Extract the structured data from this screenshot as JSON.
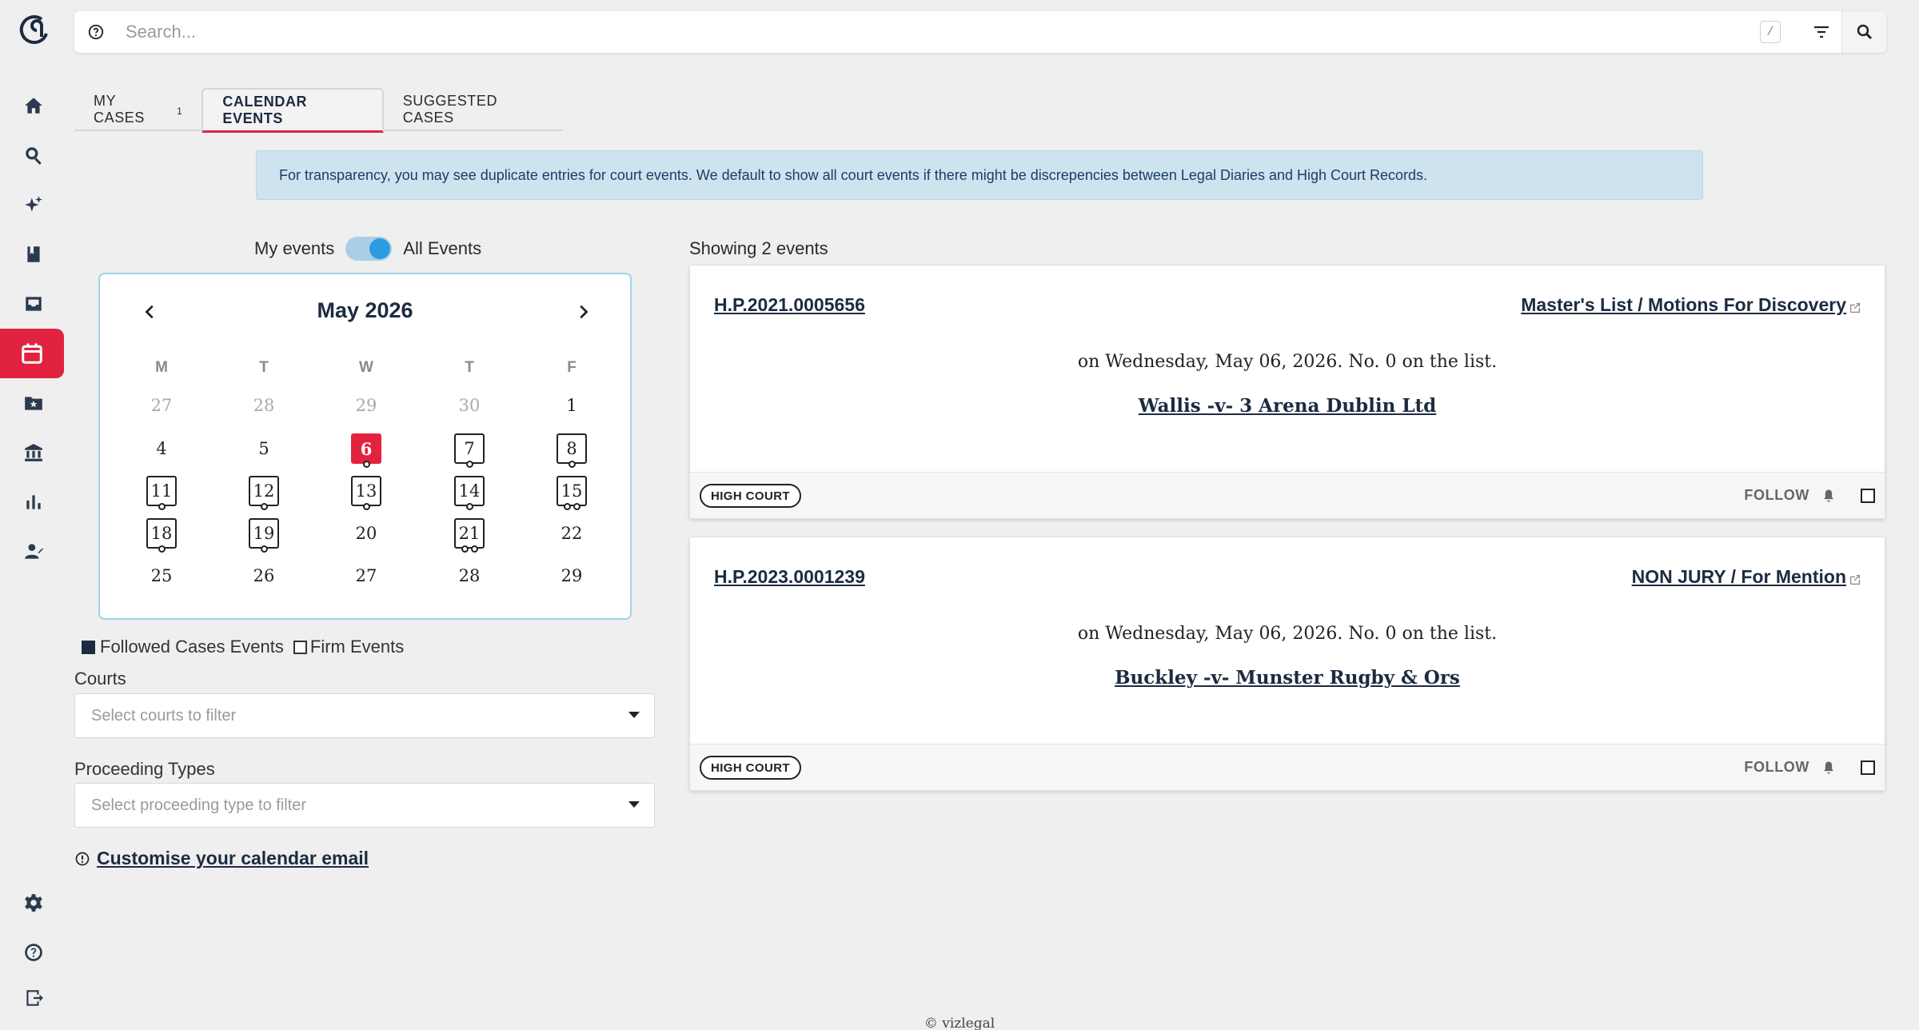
{
  "search": {
    "placeholder": "Search...",
    "shortcut": "/"
  },
  "tabs": [
    {
      "label": "MY CASES",
      "count": "1"
    },
    {
      "label": "CALENDAR EVENTS"
    },
    {
      "label": "SUGGESTED CASES"
    }
  ],
  "active_tab": "CALENDAR EVENTS",
  "banner": "For transparency, you may see duplicate entries for court events. We default to show all court events if there might be discrepencies between Legal Diaries and High Court Records.",
  "toggle": {
    "left_label": "My events",
    "right_label": "All Events",
    "state": "All Events"
  },
  "calendar": {
    "month": "May 2026",
    "weekdays": [
      "M",
      "T",
      "W",
      "T",
      "F"
    ],
    "weeks": [
      [
        {
          "d": "27",
          "muted": true
        },
        {
          "d": "28",
          "muted": true
        },
        {
          "d": "29",
          "muted": true
        },
        {
          "d": "30",
          "muted": true
        },
        {
          "d": "1"
        }
      ],
      [
        {
          "d": "4"
        },
        {
          "d": "5"
        },
        {
          "d": "6",
          "today": true,
          "dots": 1
        },
        {
          "d": "7",
          "boxed": true,
          "dots": 1
        },
        {
          "d": "8",
          "boxed": true,
          "dots": 1
        }
      ],
      [
        {
          "d": "11",
          "boxed": true,
          "dots": 1
        },
        {
          "d": "12",
          "boxed": true,
          "dots": 1
        },
        {
          "d": "13",
          "boxed": true,
          "dots": 1
        },
        {
          "d": "14",
          "boxed": true,
          "dots": 1
        },
        {
          "d": "15",
          "boxed": true,
          "dots": 2
        }
      ],
      [
        {
          "d": "18",
          "boxed": true,
          "dots": 1
        },
        {
          "d": "19",
          "boxed": true,
          "dots": 1
        },
        {
          "d": "20"
        },
        {
          "d": "21",
          "boxed": true,
          "dots": 2
        },
        {
          "d": "22"
        }
      ],
      [
        {
          "d": "25"
        },
        {
          "d": "26"
        },
        {
          "d": "27"
        },
        {
          "d": "28"
        },
        {
          "d": "29"
        }
      ]
    ]
  },
  "legend": {
    "followed": "Followed Cases Events",
    "firm": "Firm Events"
  },
  "filters": {
    "courts_label": "Courts",
    "courts_placeholder": "Select courts to filter",
    "types_label": "Proceeding Types",
    "types_placeholder": "Select proceeding type to filter"
  },
  "customise_link": "Customise your calendar email",
  "showing": "Showing 2 events",
  "events": [
    {
      "id": "H.P.2021.0005656",
      "type": "Master's List / Motions For Discovery",
      "date": "on Wednesday, May 06, 2026. No. 0 on the list.",
      "title": "Wallis -v- 3 Arena Dublin Ltd",
      "court": "HIGH COURT",
      "follow": "FOLLOW"
    },
    {
      "id": "H.P.2023.0001239",
      "type": "NON JURY / For Mention",
      "date": "on Wednesday, May 06, 2026. No. 0 on the list.",
      "title": "Buckley -v- Munster Rugby & Ors",
      "court": "HIGH COURT",
      "follow": "FOLLOW"
    }
  ],
  "footer": "© vizlegal",
  "colors": {
    "accent": "#e2233f",
    "navy": "#1c2b40",
    "toggle": "#2c9be0",
    "banner": "#cde4ee"
  }
}
